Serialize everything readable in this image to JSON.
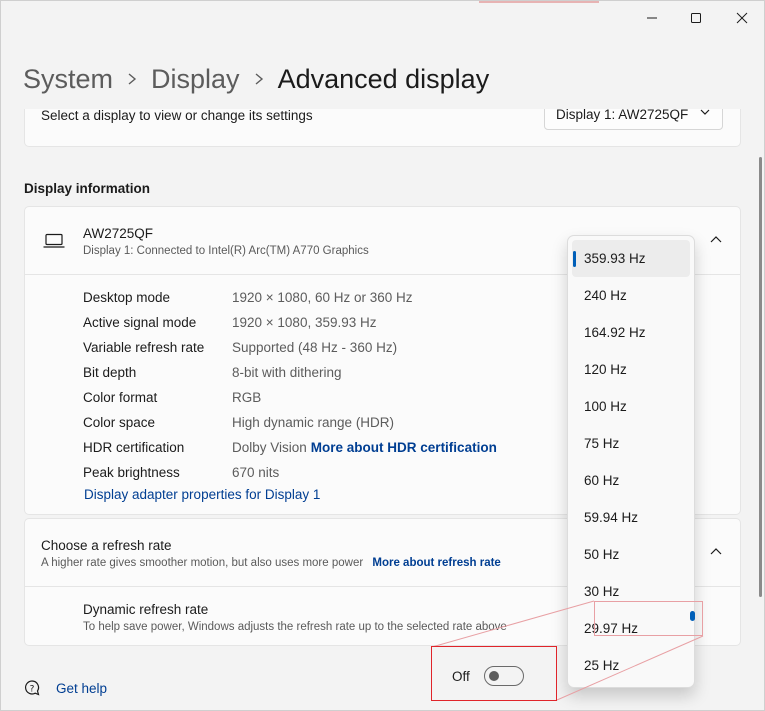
{
  "breadcrumb": {
    "system": "System",
    "display": "Display",
    "current": "Advanced display"
  },
  "select_display": {
    "label": "Select a display to view or change its settings",
    "value": "Display 1: AW2725QF"
  },
  "display_information": {
    "title": "Display information",
    "monitor_name": "AW2725QF",
    "connection": "Display 1: Connected to Intel(R) Arc(TM) A770 Graphics",
    "rows": [
      {
        "key": "Desktop mode",
        "value": "1920 × 1080, 60 Hz or 360 Hz"
      },
      {
        "key": "Active signal mode",
        "value": "1920 × 1080, 359.93 Hz"
      },
      {
        "key": "Variable refresh rate",
        "value": "Supported (48 Hz - 360 Hz)"
      },
      {
        "key": "Bit depth",
        "value": "8-bit with dithering"
      },
      {
        "key": "Color format",
        "value": "RGB"
      },
      {
        "key": "Color space",
        "value": "High dynamic range (HDR)"
      },
      {
        "key": "HDR certification",
        "value": "Dolby Vision",
        "link": "More about HDR certification"
      },
      {
        "key": "Peak brightness",
        "value": "670 nits"
      }
    ],
    "adapter_link": "Display adapter properties for Display 1"
  },
  "refresh_rate": {
    "title": "Choose a refresh rate",
    "subtitle": "A higher rate gives smoother motion, but also uses more power",
    "link": "More about refresh rate",
    "dynamic_title": "Dynamic refresh rate",
    "dynamic_subtitle": "To help save power, Windows adjusts the refresh rate up to the selected rate above",
    "toggle_label": "Off"
  },
  "refresh_options": [
    "359.93 Hz",
    "240 Hz",
    "164.92 Hz",
    "120 Hz",
    "100 Hz",
    "75 Hz",
    "60 Hz",
    "59.94 Hz",
    "50 Hz",
    "30 Hz",
    "29.97 Hz",
    "25 Hz"
  ],
  "selected_option": "359.93 Hz",
  "help": {
    "label": "Get help"
  },
  "colors": {
    "accent": "#005fb8",
    "link": "#003e92",
    "highlight": "#e0242a"
  }
}
